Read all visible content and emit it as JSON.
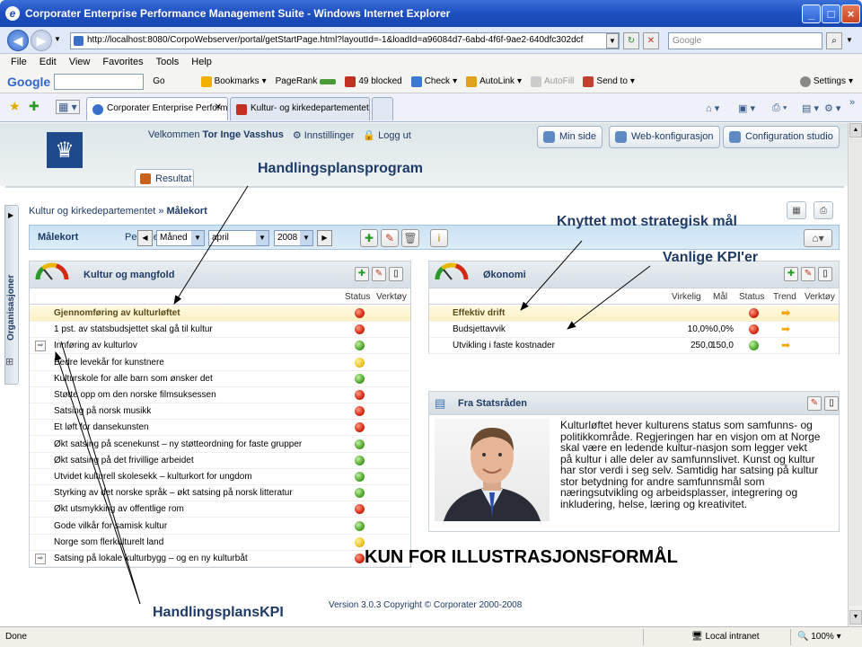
{
  "window": {
    "title": "Corporater Enterprise Performance Management Suite - Windows Internet Explorer"
  },
  "browser": {
    "url": "http://localhost:8080/CorpoWebserver/portal/getStartPage.html?layoutId=-1&loadId=a96084d7-6abd-4f6f-9ae2-640dfc302dcf",
    "search_placeholder": "Google",
    "menu": [
      "File",
      "Edit",
      "View",
      "Favorites",
      "Tools",
      "Help"
    ],
    "google_toolbar": {
      "logo": "Google",
      "go": "Go",
      "bookmarks": "Bookmarks",
      "pagerank": "PageRank",
      "blocked": "49 blocked",
      "check": "Check",
      "autolink": "AutoLink",
      "autofill": "AutoFill",
      "sendto": "Send to",
      "settings": "Settings"
    },
    "tabs": [
      {
        "label": "Corporater Enterprise Perform..."
      },
      {
        "label": "Kultur- og kirkedepartementet - re..."
      }
    ]
  },
  "app": {
    "user_greeting": "Velkommen",
    "user_name": "Tor Inge Vasshus",
    "settings": "Innstillinger",
    "logout": "Logg ut",
    "top_buttons": [
      "Min side",
      "Web-konfigurasjon",
      "Configuration studio"
    ],
    "result_tab": "Resultat",
    "side_tab": "Organisasjoner",
    "breadcrumb_parent": "Kultur og kirkedepartementet",
    "breadcrumb_sep": "»",
    "breadcrumb_current": "Målekort",
    "filter": {
      "title": "Målekort",
      "period_label": "Periode:",
      "period_type": "Måned",
      "month": "april",
      "year": "2008"
    }
  },
  "panel_culture": {
    "title": "Kultur og mangfold",
    "col_status": "Status",
    "col_tools": "Verktøy",
    "rows": [
      {
        "label": "Gjennomføring av kulturløftet",
        "status": "red",
        "group": true
      },
      {
        "label": "1 pst. av statsbudsjettet skal gå til kultur",
        "status": "red"
      },
      {
        "label": "Innføring av kulturlov",
        "status": "green",
        "icon": true
      },
      {
        "label": "Bedre levekår for kunstnere",
        "status": "yellow"
      },
      {
        "label": "Kulturskole for alle barn som ønsker det",
        "status": "green"
      },
      {
        "label": "Støtte opp om den norske filmsuksessen",
        "status": "red"
      },
      {
        "label": "Satsing på norsk musikk",
        "status": "red"
      },
      {
        "label": "Et løft for dansekunsten",
        "status": "red"
      },
      {
        "label": "Økt satsing på scenekunst – ny støtteordning for faste grupper",
        "status": "green"
      },
      {
        "label": "Økt satsing på det frivillige arbeidet",
        "status": "green"
      },
      {
        "label": "Utvidet kulturell skolesekk – kulturkort for ungdom",
        "status": "green"
      },
      {
        "label": "Styrking av det norske språk – økt satsing på norsk litteratur",
        "status": "green"
      },
      {
        "label": "Økt utsmykking av offentlige rom",
        "status": "red"
      },
      {
        "label": "Gode vilkår for samisk kultur",
        "status": "green"
      },
      {
        "label": "Norge som flerkulturelt land",
        "status": "yellow"
      },
      {
        "label": "Satsing på lokale kulturbygg – og en ny kulturbåt",
        "status": "red",
        "icon": true
      }
    ]
  },
  "panel_economy": {
    "title": "Økonomi",
    "cols": [
      "Virkelig",
      "Mål",
      "Status",
      "Trend",
      "Verktøy"
    ],
    "rows": [
      {
        "label": "Effektiv drift",
        "actual": "",
        "target": "",
        "status": "red",
        "group": true
      },
      {
        "label": "Budsjettavvik",
        "actual": "10,0%",
        "target": "0,0%",
        "status": "red"
      },
      {
        "label": "Utvikling i faste kostnader",
        "actual": "250,0",
        "target": "150,0",
        "status": "green"
      }
    ]
  },
  "panel_minister": {
    "title": "Fra Statsråden",
    "text": "Kulturløftet hever kulturens status som samfunns- og politikkområde. Regjeringen har en visjon om at Norge skal være en ledende kultur-nasjon som legger vekt på kultur i alle deler av samfunnslivet. Kunst og kultur har stor verdi i seg selv. Samtidig har satsing på kultur stor betydning for andre samfunnsmål som næringsutvikling og arbeidsplasser, integrering og inkludering, helse, læring og kreativitet."
  },
  "footer": {
    "version": "Version 3.0.3 Copyright © Corporater 2000-2008",
    "disclaimer": "KUN FOR ILLUSTRASJONSFORMÅL"
  },
  "annotations": {
    "program": "Handlingsplansprogram",
    "strategic": "Knyttet mot strategisk mål",
    "kpi": "Vanlige KPI'er",
    "action_kpi": "HandlingsplansKPI"
  },
  "statusbar": {
    "left": "Done",
    "zone": "Local intranet",
    "zoom": "100%"
  },
  "colors": {
    "titlebar": "#1d4fc0",
    "status_red": "#d42a12",
    "status_green": "#4fa62c",
    "status_yellow": "#ecc41a",
    "accent": "#1e3a66"
  }
}
